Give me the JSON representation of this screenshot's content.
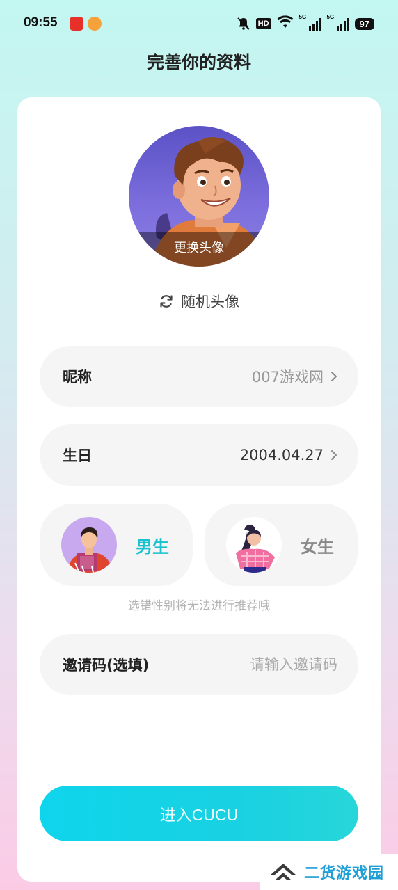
{
  "status_bar": {
    "time": "09:55",
    "hd_label": "HD",
    "network_label_1": "5G",
    "network_label_2": "5G",
    "battery": "97"
  },
  "header": {
    "title": "完善你的资料"
  },
  "profile": {
    "change_avatar_label": "更换头像",
    "random_avatar_label": "随机头像"
  },
  "form": {
    "nickname": {
      "label": "昵称",
      "value": "007游戏网"
    },
    "birthday": {
      "label": "生日",
      "value": "2004.04.27"
    },
    "gender": {
      "male_label": "男生",
      "female_label": "女生",
      "selected": "male",
      "hint": "选错性别将无法进行推荐哦"
    },
    "invite": {
      "label": "邀请码(选填)",
      "placeholder": "请输入邀请码",
      "value": ""
    }
  },
  "actions": {
    "enter_label": "进入CUCU"
  },
  "watermark": {
    "text": "二货游戏园"
  },
  "colors": {
    "accent": "#1ac2cf",
    "button_start": "#0fd5ec",
    "button_end": "#27d6d9",
    "watermark": "#1e9fd6"
  }
}
